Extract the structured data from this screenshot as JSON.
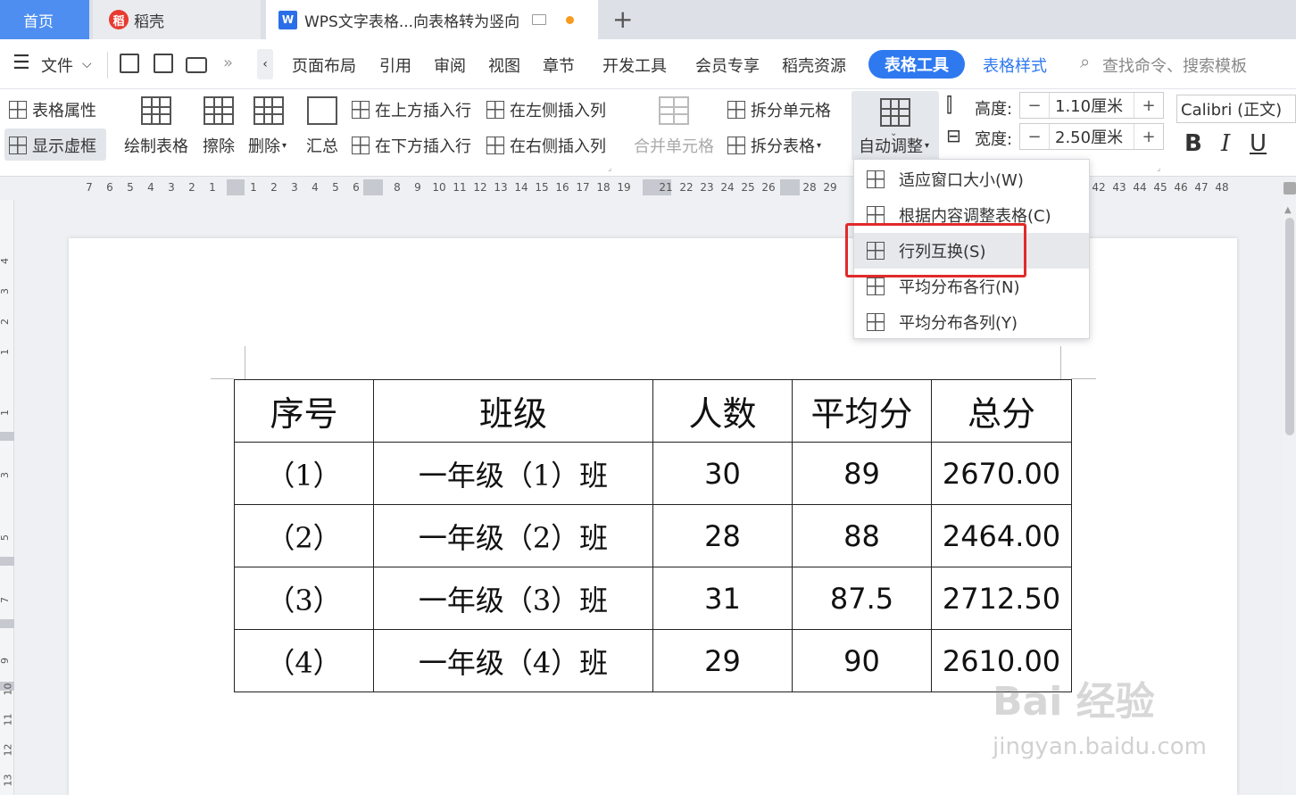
{
  "tabs": {
    "home": "首页",
    "docer": "稻壳",
    "doc": "WPS文字表格...向表格转为竖向"
  },
  "menu": {
    "file": "文件",
    "items": [
      "页面布局",
      "引用",
      "审阅",
      "视图",
      "章节",
      "开发工具",
      "会员专享",
      "稻壳资源"
    ],
    "table_tools": "表格工具",
    "table_style": "表格样式",
    "search": "查找命令、搜索模板"
  },
  "toolbar": {
    "table_props": "表格属性",
    "show_grid": "显示虚框",
    "draw_table": "绘制表格",
    "erase": "擦除",
    "delete": "删除",
    "summary": "汇总",
    "insert_above": "在上方插入行",
    "insert_below": "在下方插入行",
    "insert_left": "在左侧插入列",
    "insert_right": "在右侧插入列",
    "merge_cells": "合并单元格",
    "split_cell": "拆分单元格",
    "split_table": "拆分表格",
    "auto_adjust": "自动调整",
    "height_label": "高度:",
    "height_value": "1.10厘米",
    "width_label": "宽度:",
    "width_value": "2.50厘米",
    "font": "Calibri (正文)",
    "bold": "B",
    "italic": "I",
    "underline": "U",
    "minus": "−",
    "plus": "+"
  },
  "dropdown": {
    "items": [
      "适应窗口大小(W)",
      "根据内容调整表格(C)",
      "行列互换(S)",
      "平均分布各行(N)",
      "平均分布各列(Y)"
    ]
  },
  "table": {
    "headers": [
      "序号",
      "班级",
      "人数",
      "平均分",
      "总分"
    ],
    "rows": [
      [
        "（1）",
        "一年级（1）班",
        "30",
        "89",
        "2670.00"
      ],
      [
        "（2）",
        "一年级（2）班",
        "28",
        "88",
        "2464.00"
      ],
      [
        "（3）",
        "一年级（3）班",
        "31",
        "87.5",
        "2712.50"
      ],
      [
        "（4）",
        "一年级（4）班",
        "29",
        "90",
        "2610.00"
      ]
    ]
  },
  "watermark": {
    "line1": "Bai 经验",
    "line2": "jingyan.baidu.com"
  },
  "colors": {
    "accent": "#2f79f0",
    "highlight": "#e12a2a",
    "home_tab": "#4e8ef1"
  }
}
